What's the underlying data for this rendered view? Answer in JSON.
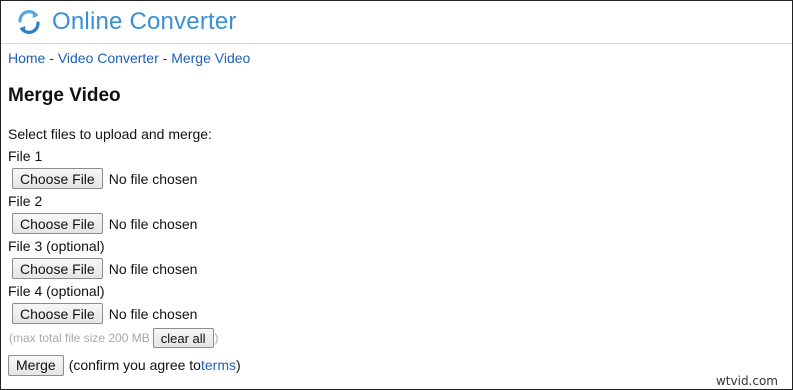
{
  "header": {
    "site_title": "Online Converter",
    "logo_icon": "refresh-arrows-icon"
  },
  "breadcrumb": {
    "home": "Home",
    "sep1": " - ",
    "video_converter": "Video Converter",
    "sep2": " - ",
    "merge_video": "Merge Video"
  },
  "page": {
    "title": "Merge Video",
    "instructions": "Select files to upload and merge:"
  },
  "files": [
    {
      "label": "File 1",
      "button": "Choose File",
      "status": "No file chosen"
    },
    {
      "label": "File 2",
      "button": "Choose File",
      "status": "No file chosen"
    },
    {
      "label": "File 3 (optional)",
      "button": "Choose File",
      "status": "No file chosen"
    },
    {
      "label": "File 4 (optional)",
      "button": "Choose File",
      "status": "No file chosen"
    }
  ],
  "limits": {
    "prefix": "(max total file size 200 MB",
    "clear_button": "clear all",
    "suffix": ")"
  },
  "actions": {
    "merge_button": "Merge",
    "confirm_prefix": "(confirm you agree to ",
    "terms_link": "terms",
    "confirm_suffix": ")"
  },
  "watermark": "wtvid.com",
  "colors": {
    "brand": "#3a8fd6",
    "link": "#1f5fb8",
    "muted": "#a9a9a9"
  }
}
